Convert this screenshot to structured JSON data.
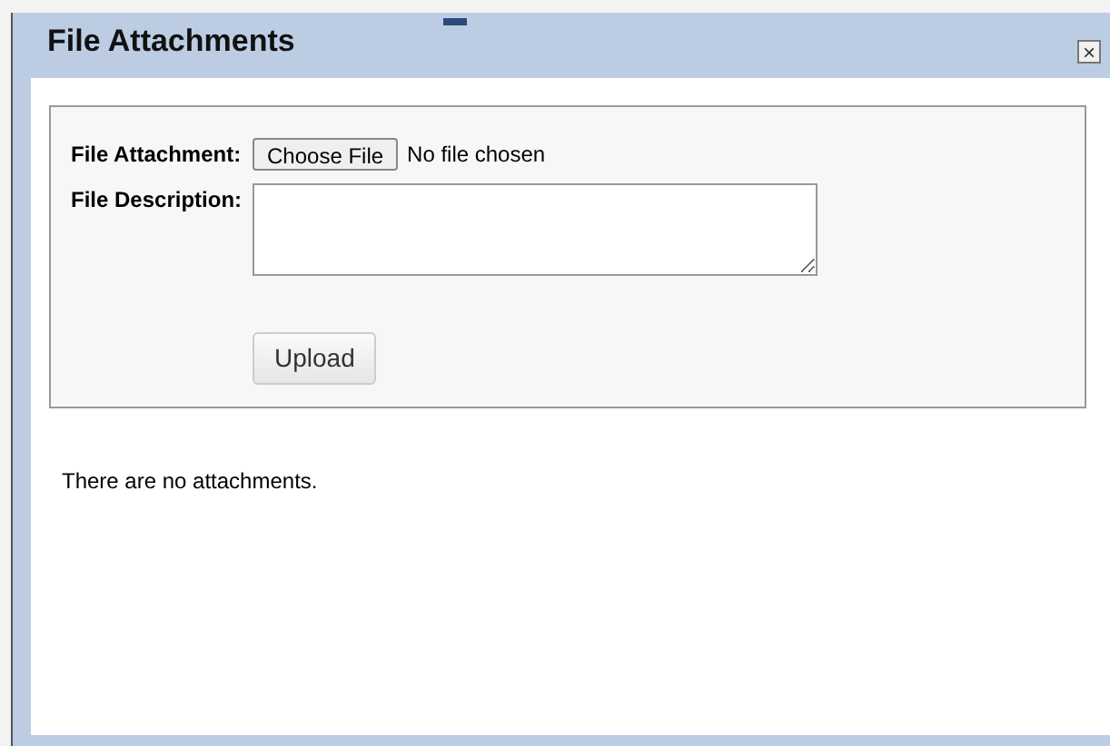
{
  "dialog": {
    "title": "File Attachments",
    "close_glyph": "×"
  },
  "form": {
    "attachment_label": "File Attachment:",
    "choose_button": "Choose File",
    "file_status": "No file chosen",
    "description_label": "File Description:",
    "upload_button": "Upload"
  },
  "message": "There are no attachments."
}
